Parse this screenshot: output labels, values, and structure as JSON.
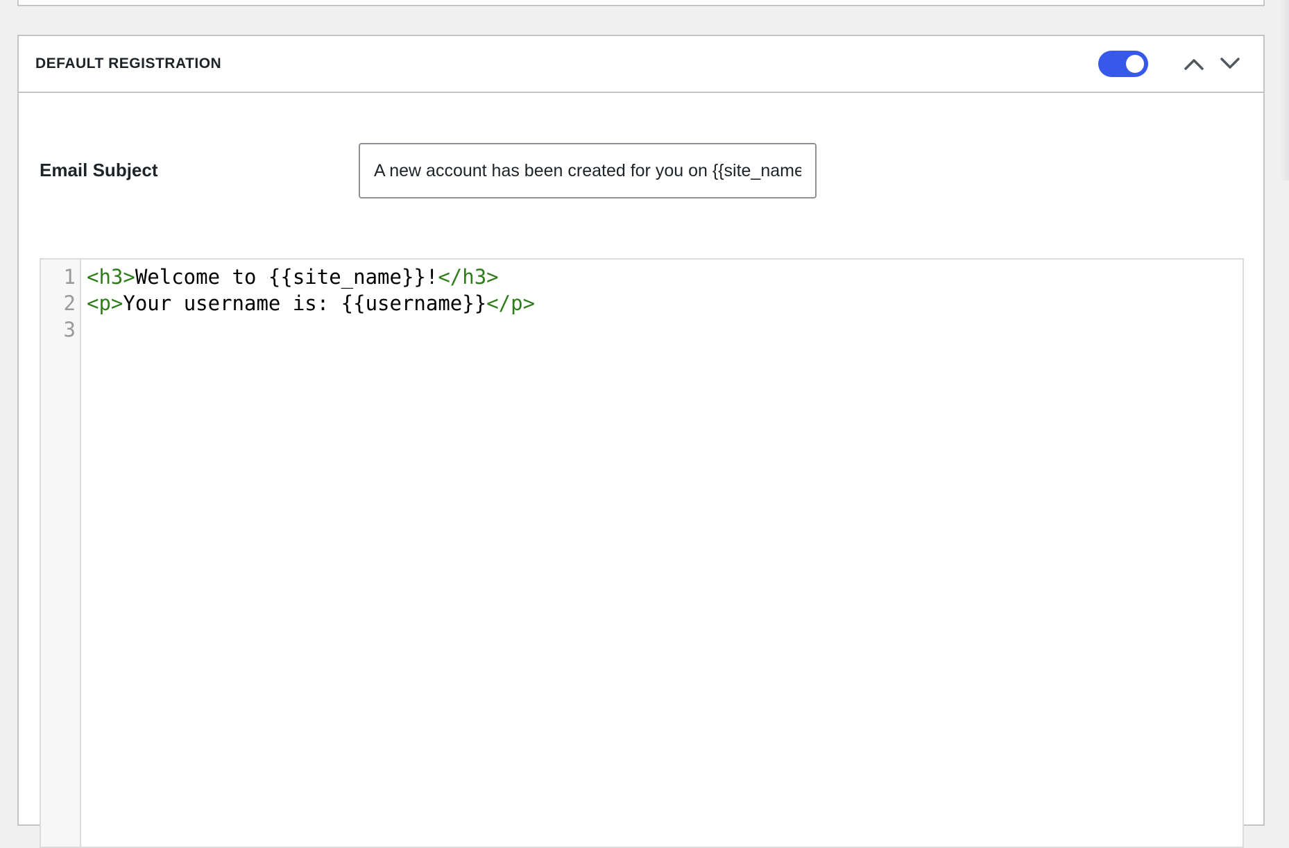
{
  "panel": {
    "title": "DEFAULT REGISTRATION",
    "toggle_enabled": true,
    "accent_color": "#3858e9"
  },
  "fields": {
    "subject_label": "Email Subject",
    "subject_value": "A new account has been created for you on {{site_name}}"
  },
  "editor": {
    "line_numbers": [
      "1",
      "2",
      "3"
    ],
    "lines": [
      {
        "open_tag": "<h3>",
        "text": "Welcome to {{site_name}}!",
        "close_tag": "</h3>"
      },
      {
        "open_tag": "<p>",
        "text": "Your username is: {{username}}",
        "close_tag": "</p>"
      },
      {
        "open_tag": "",
        "text": "",
        "close_tag": ""
      }
    ],
    "tag_color": "#2e7d1a"
  },
  "icons": {
    "move_up": "chevron-up-icon",
    "move_down": "chevron-down-icon"
  }
}
